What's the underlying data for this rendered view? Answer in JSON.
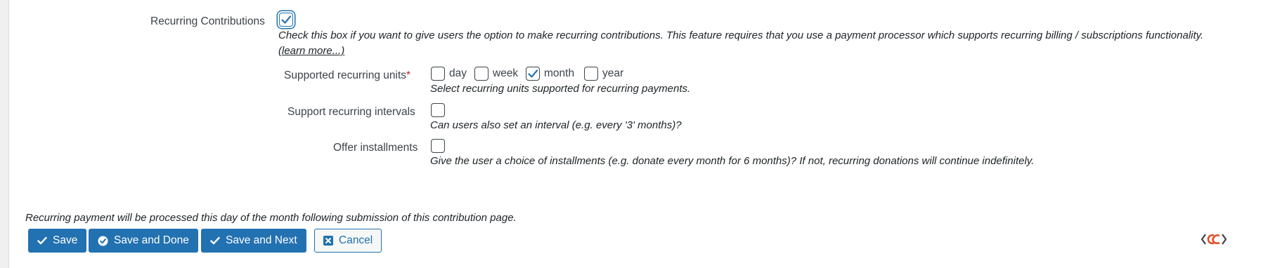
{
  "recurring": {
    "label": "Recurring Contributions",
    "checked": true,
    "description": "Check this box if you want to give users the option to make recurring contributions. This feature requires that you use a payment processor which supports recurring billing / subscriptions functionality.",
    "learn_more": "(learn more...)"
  },
  "units": {
    "label": "Supported recurring units",
    "required_mark": "*",
    "options": [
      {
        "label": "day",
        "checked": false
      },
      {
        "label": "week",
        "checked": false
      },
      {
        "label": "month",
        "checked": true
      },
      {
        "label": "year",
        "checked": false
      }
    ],
    "description": "Select recurring units supported for recurring payments."
  },
  "intervals": {
    "label": "Support recurring intervals",
    "checked": false,
    "description": "Can users also set an interval (e.g. every '3' months)?"
  },
  "installments": {
    "label": "Offer installments",
    "checked": false,
    "description": "Give the user a choice of installments (e.g. donate every month for 6 months)? If not, recurring donations will continue indefinitely."
  },
  "footer_note": "Recurring payment will be processed this day of the month following submission of this contribution page.",
  "buttons": {
    "save": "Save",
    "save_done": "Save and Done",
    "save_next": "Save and Next",
    "cancel": "Cancel"
  },
  "colors": {
    "primary": "#2271b1",
    "required": "#b32d2e",
    "logo_red": "#e44d26"
  },
  "icons": {
    "save": "check-icon",
    "save_done": "check-circle-icon",
    "save_next": "check-icon",
    "cancel": "close-icon",
    "logo": "civicrm-logo"
  }
}
